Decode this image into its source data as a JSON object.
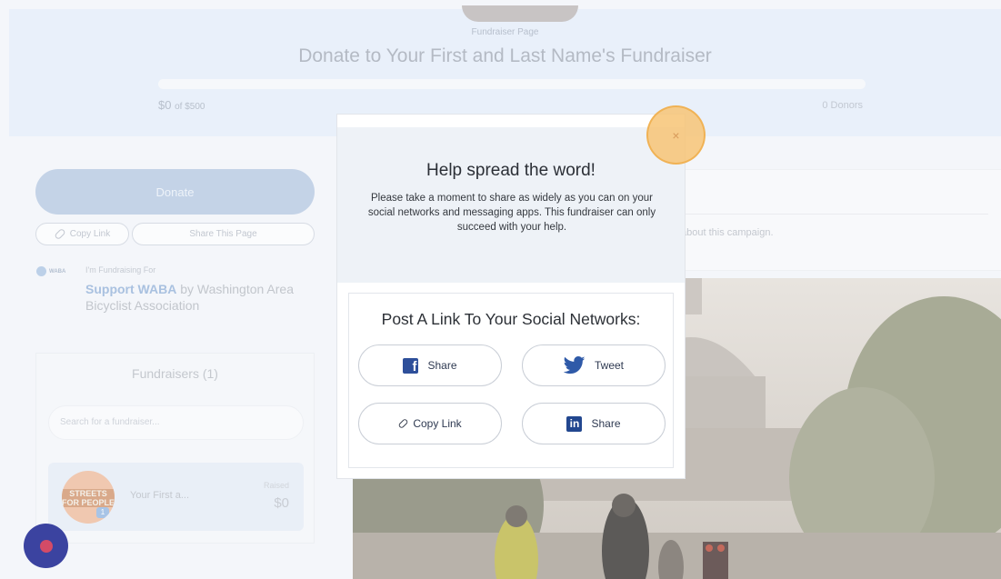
{
  "hero": {
    "kicker": "Fundraiser Page",
    "title": "Donate to Your First and Last Name's Fundraiser",
    "raised_amount": "$0",
    "raised_goal": "of $500",
    "donors": "0 Donors",
    "progress": 0
  },
  "actions": {
    "donate_label": "Donate",
    "copy_link_label": "Copy Link",
    "share_page_label": "Share This Page"
  },
  "fundraising_for": {
    "logo_text": "WABA",
    "label": "I'm Fundraising For",
    "org_link": "Support WABA",
    "org_suffix": " by Washington Area Bicyclist Association"
  },
  "fundraisers": {
    "heading": "Fundraisers (1)",
    "search_placeholder": "Search for a fundraiser...",
    "items": [
      {
        "avatar_text": "STREETS FOR PEOPLE",
        "badge": "1",
        "name": "Your First a...",
        "raised_label": "Raised",
        "raised_value": "$0"
      }
    ]
  },
  "about": {
    "text": "about this campaign."
  },
  "modal": {
    "close_glyph": "×",
    "title": "Help spread the word!",
    "description": "Please take a moment to share as widely as you can on your social networks and messaging apps. This fundraiser can only succeed with your help.",
    "social_heading": "Post A Link To Your Social Networks:",
    "buttons": {
      "facebook": "Share",
      "twitter": "Tweet",
      "copy_link": "Copy Link",
      "linkedin": "Share"
    },
    "icons": {
      "facebook": "facebook-icon",
      "twitter": "twitter-icon",
      "copy_link": "link-icon",
      "linkedin": "linkedin-icon"
    }
  },
  "colors": {
    "accent": "#3b43a0",
    "facebook": "#2e4f9a",
    "twitter": "#2f5aa8",
    "linkedin": "#22478f",
    "highlight": "#f7c476"
  }
}
